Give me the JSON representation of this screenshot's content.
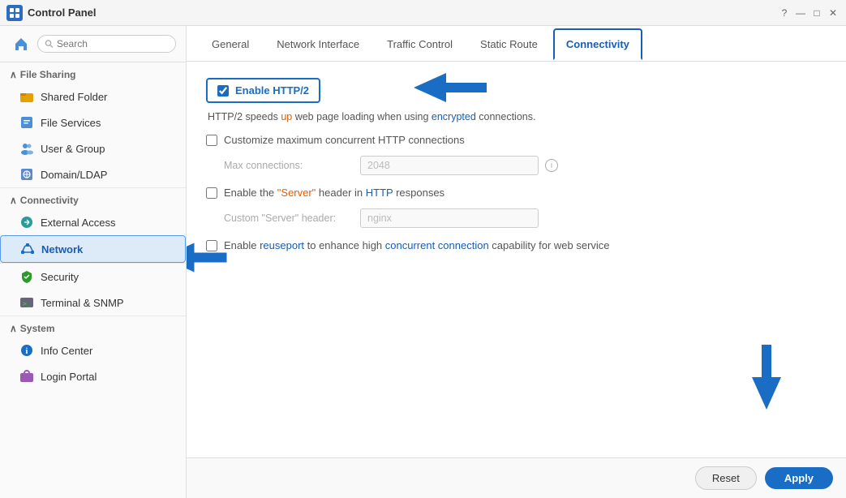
{
  "titleBar": {
    "title": "Control Panel",
    "controls": [
      "?",
      "—",
      "□",
      "✕"
    ]
  },
  "sidebar": {
    "searchPlaceholder": "Search",
    "sections": [
      {
        "id": "file-sharing",
        "label": "File Sharing",
        "expanded": true,
        "items": [
          {
            "id": "shared-folder",
            "label": "Shared Folder",
            "icon": "folder-yellow"
          },
          {
            "id": "file-services",
            "label": "File Services",
            "icon": "file-services"
          },
          {
            "id": "user-group",
            "label": "User & Group",
            "icon": "user-group"
          },
          {
            "id": "domain-ldap",
            "label": "Domain/LDAP",
            "icon": "domain"
          }
        ]
      },
      {
        "id": "connectivity",
        "label": "Connectivity",
        "expanded": true,
        "items": [
          {
            "id": "external-access",
            "label": "External Access",
            "icon": "external"
          },
          {
            "id": "network",
            "label": "Network",
            "icon": "network",
            "active": true
          }
        ]
      },
      {
        "id": "security-single",
        "items": [
          {
            "id": "security",
            "label": "Security",
            "icon": "security"
          },
          {
            "id": "terminal-snmp",
            "label": "Terminal & SNMP",
            "icon": "terminal"
          }
        ]
      },
      {
        "id": "system",
        "label": "System",
        "expanded": true,
        "items": [
          {
            "id": "info-center",
            "label": "Info Center",
            "icon": "info"
          },
          {
            "id": "login-portal",
            "label": "Login Portal",
            "icon": "login"
          }
        ]
      }
    ]
  },
  "tabs": [
    {
      "id": "general",
      "label": "General",
      "active": false
    },
    {
      "id": "network-interface",
      "label": "Network Interface",
      "active": false
    },
    {
      "id": "traffic-control",
      "label": "Traffic Control",
      "active": false
    },
    {
      "id": "static-route",
      "label": "Static Route",
      "active": false
    },
    {
      "id": "connectivity",
      "label": "Connectivity",
      "active": true
    }
  ],
  "content": {
    "http2": {
      "checkLabel": "Enable HTTP/2",
      "description": "HTTP/2 speeds up web page loading when using encrypted connections."
    },
    "maxConnections": {
      "checkLabel": "Customize maximum concurrent HTTP connections",
      "fieldLabel": "Max connections:",
      "fieldValue": "2048"
    },
    "serverHeader": {
      "checkLabel": "Enable the \"Server\" header in HTTP responses",
      "fieldLabel": "Custom \"Server\" header:",
      "fieldValue": "nginx"
    },
    "reuseport": {
      "checkLabel": "Enable reuseport to enhance high concurrent connection capability for web service"
    }
  },
  "footer": {
    "resetLabel": "Reset",
    "applyLabel": "Apply"
  }
}
